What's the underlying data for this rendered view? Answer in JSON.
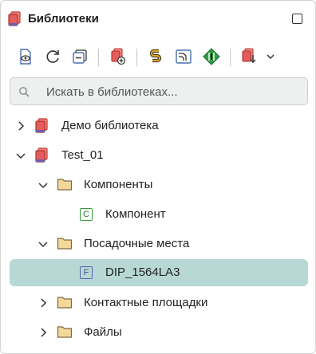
{
  "panel": {
    "title": "Библиотеки",
    "icons": {
      "app": "library-books-icon",
      "maximize": "maximize-icon"
    }
  },
  "toolbar": {
    "buttons": [
      {
        "name": "view-document-icon"
      },
      {
        "name": "refresh-icon"
      },
      {
        "name": "collapse-all-icon"
      },
      {
        "name": "add-library-icon"
      },
      {
        "name": "yellow-s-icon"
      },
      {
        "name": "image-frame-icon"
      },
      {
        "name": "green-diamond-icon"
      },
      {
        "name": "export-library-icon"
      },
      {
        "name": "chevron-down-icon"
      }
    ]
  },
  "search": {
    "placeholder": "Искать в библиотеках..."
  },
  "tree": {
    "items": [
      {
        "label": "Демо библиотека",
        "expanded": false,
        "icon": "library-books-icon"
      },
      {
        "label": "Test_01",
        "expanded": true,
        "icon": "library-books-icon"
      },
      {
        "label": "Компоненты",
        "expanded": true,
        "icon": "folder-icon"
      },
      {
        "label": "Компонент",
        "icon": "component-c-icon",
        "badge": "C"
      },
      {
        "label": "Посадочные места",
        "expanded": true,
        "icon": "folder-icon"
      },
      {
        "label": "DIP_1564LA3",
        "icon": "footprint-f-icon",
        "badge": "F",
        "selected": true
      },
      {
        "label": "Контактные площадки",
        "expanded": false,
        "icon": "folder-icon"
      },
      {
        "label": "Файлы",
        "expanded": false,
        "icon": "folder-icon"
      }
    ]
  },
  "colors": {
    "selected_row": "#b8d8d5",
    "library_red": "#d9534f",
    "folder": "#f3d89a",
    "component_green": "#3a9a3a",
    "footprint_blue": "#5a63b0"
  }
}
